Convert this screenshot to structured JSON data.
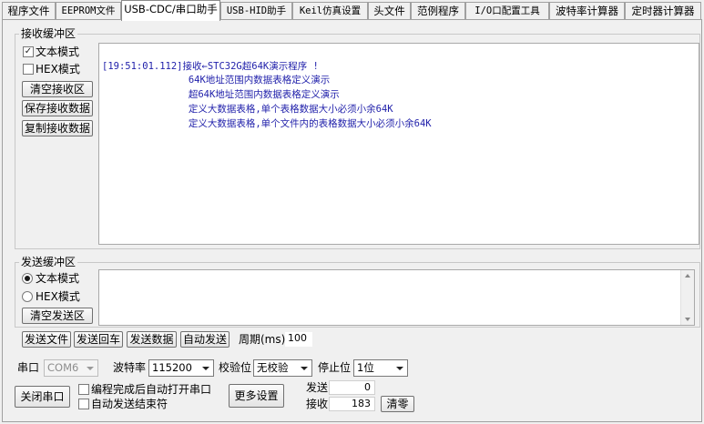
{
  "tabs": [
    {
      "label": "程序文件"
    },
    {
      "label": "EEPROM文件"
    },
    {
      "label": "USB-CDC/串口助手"
    },
    {
      "label": "USB-HID助手"
    },
    {
      "label": "Keil仿真设置"
    },
    {
      "label": "头文件"
    },
    {
      "label": "范例程序"
    },
    {
      "label": "I/O口配置工具"
    },
    {
      "label": "波特率计算器"
    },
    {
      "label": "定时器计算器"
    }
  ],
  "receive": {
    "group_label": "接收缓冲区",
    "text_mode_label": "文本模式",
    "hex_mode_label": "HEX模式",
    "text_mode_checked": true,
    "hex_mode_checked": false,
    "clear_button": "清空接收区",
    "save_button": "保存接收数据",
    "copy_button": "复制接收数据",
    "lines": [
      "[19:51:01.112]接收←STC32G超64K演示程序 !",
      "               64K地址范围内数据表格定义演示",
      "               超64K地址范围内数据表格定义演示",
      "               定义大数据表格,单个表格数据大小必须小余64K",
      "               定义大数据表格,单个文件内的表格数据大小必须小余64K"
    ]
  },
  "send": {
    "group_label": "发送缓冲区",
    "text_mode_label": "文本模式",
    "hex_mode_label": "HEX模式",
    "selected_mode": "text",
    "clear_button": "清空发送区",
    "send_file_button": "发送文件",
    "send_enter_button": "发送回车",
    "send_data_button": "发送数据",
    "auto_send_button": "自动发送",
    "period_label": "周期(ms)",
    "period_value": "100"
  },
  "serial": {
    "port_label": "串口",
    "port_value": "COM6",
    "baud_label": "波特率",
    "baud_value": "115200",
    "parity_label": "校验位",
    "parity_value": "无校验",
    "stop_label": "停止位",
    "stop_value": "1位",
    "close_button": "关闭串口",
    "auto_open_label": "编程完成后自动打开串口",
    "auto_end_label": "自动发送结束符",
    "more_settings_button": "更多设置",
    "sent_label": "发送",
    "sent_count": "0",
    "received_label": "接收",
    "received_count": "183",
    "clear_count_button": "清零"
  },
  "colors": {
    "receive_text": "#1f1faa"
  }
}
